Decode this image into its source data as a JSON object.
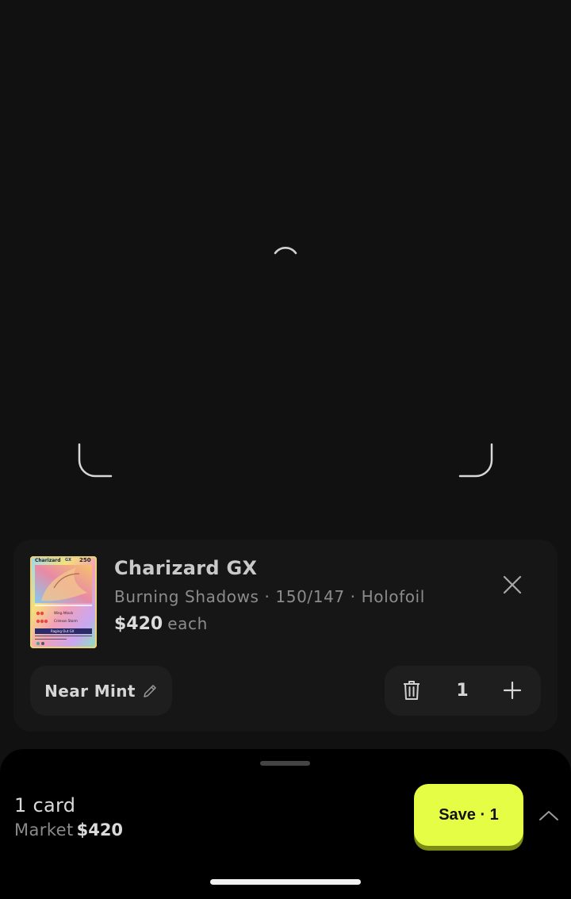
{
  "card": {
    "name": "Charizard GX",
    "details": "Burning Shadows · 150/147 · Holofoil",
    "price": "$420",
    "price_unit": "each",
    "thumbnail": {
      "name": "Charizard",
      "stage_tag": "GX",
      "hp": "250",
      "attack_1": "Wing Attack",
      "attack_2": "Crimson Storm",
      "gx_attack": "Raging Out GX"
    }
  },
  "condition": {
    "label": "Near Mint"
  },
  "quantity": {
    "value": "1"
  },
  "summary": {
    "count": "1 card",
    "market_label": "Market",
    "market_value": "$420"
  },
  "save_button": {
    "label": "Save · 1"
  },
  "colors": {
    "accent": "#e6fd45",
    "background": "#111111",
    "sheet": "#000000"
  },
  "icons": {
    "close": "close-icon",
    "edit": "pencil-icon",
    "delete": "trash-icon",
    "add": "plus-icon",
    "expand": "chevron-up-icon",
    "loading": "spinner-icon"
  }
}
